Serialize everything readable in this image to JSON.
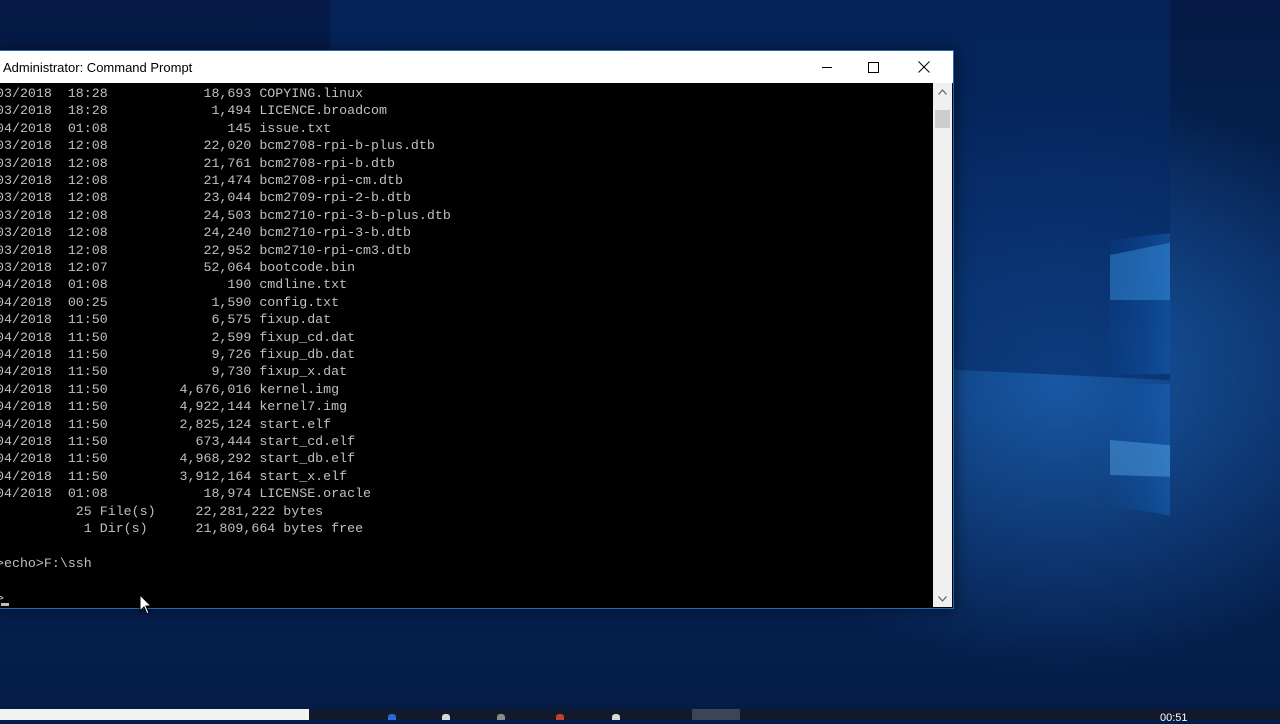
{
  "window": {
    "title": "Administrator: Command Prompt",
    "console_lines": [
      "03/2018  18:28            18,693 COPYING.linux",
      "03/2018  18:28             1,494 LICENCE.broadcom",
      "04/2018  01:08               145 issue.txt",
      "03/2018  12:08            22,020 bcm2708-rpi-b-plus.dtb",
      "03/2018  12:08            21,761 bcm2708-rpi-b.dtb",
      "03/2018  12:08            21,474 bcm2708-rpi-cm.dtb",
      "03/2018  12:08            23,044 bcm2709-rpi-2-b.dtb",
      "03/2018  12:08            24,503 bcm2710-rpi-3-b-plus.dtb",
      "03/2018  12:08            24,240 bcm2710-rpi-3-b.dtb",
      "03/2018  12:08            22,952 bcm2710-rpi-cm3.dtb",
      "03/2018  12:07            52,064 bootcode.bin",
      "04/2018  01:08               190 cmdline.txt",
      "04/2018  00:25             1,590 config.txt",
      "04/2018  11:50             6,575 fixup.dat",
      "04/2018  11:50             2,599 fixup_cd.dat",
      "04/2018  11:50             9,726 fixup_db.dat",
      "04/2018  11:50             9,730 fixup_x.dat",
      "04/2018  11:50         4,676,016 kernel.img",
      "04/2018  11:50         4,922,144 kernel7.img",
      "04/2018  11:50         2,825,124 start.elf",
      "04/2018  11:50           673,444 start_cd.elf",
      "04/2018  11:50         4,968,292 start_db.elf",
      "04/2018  11:50         3,912,164 start_x.elf",
      "04/2018  01:08            18,974 LICENSE.oracle",
      "          25 File(s)     22,281,222 bytes",
      "           1 Dir(s)      21,809,664 bytes free",
      "",
      ">echo>F:\\ssh",
      "",
      ">"
    ]
  },
  "taskbar": {
    "clock": "00:51"
  },
  "colors": {
    "console_bg": "#000000",
    "console_text": "#c0c0c0",
    "titlebar_bg": "#ffffff",
    "window_border": "#1e6bb8",
    "wallpaper": "#062657"
  }
}
